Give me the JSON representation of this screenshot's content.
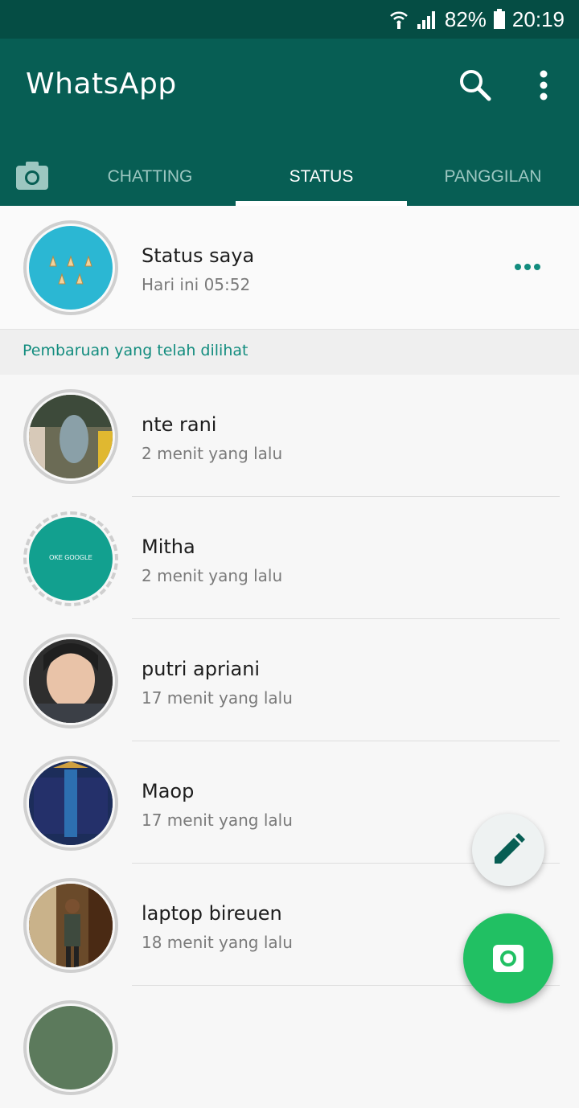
{
  "status_bar": {
    "battery": "82%",
    "time": "20:19"
  },
  "app": {
    "title": "WhatsApp"
  },
  "icons": {
    "search": "search-icon",
    "menu": "more-vert-icon",
    "camera_tab": "camera-icon",
    "more": "more-horiz-icon",
    "fab_edit": "pencil-icon",
    "fab_camera": "camera-icon"
  },
  "tabs": [
    {
      "label": "CHATTING",
      "active": false
    },
    {
      "label": "STATUS",
      "active": true
    },
    {
      "label": "PANGGILAN",
      "active": false
    }
  ],
  "my_status": {
    "name": "Status saya",
    "time": "Hari ini 05:52"
  },
  "section_header": "Pembaruan yang telah dilihat",
  "contacts": [
    {
      "name": "nte rani",
      "time": "2 menit yang lalu"
    },
    {
      "name": "Mitha",
      "time": "2 menit yang lalu",
      "avatar_text": "OKE GOOGLE"
    },
    {
      "name": "putri apriani",
      "time": "17 menit yang lalu"
    },
    {
      "name": "Maop",
      "time": "17 menit yang lalu"
    },
    {
      "name": "laptop bireuen",
      "time": "18 menit yang lalu"
    }
  ],
  "colors": {
    "primary_dark": "#054d44",
    "primary": "#075e54",
    "accent": "#21c063",
    "teal_text": "#128c7e"
  }
}
